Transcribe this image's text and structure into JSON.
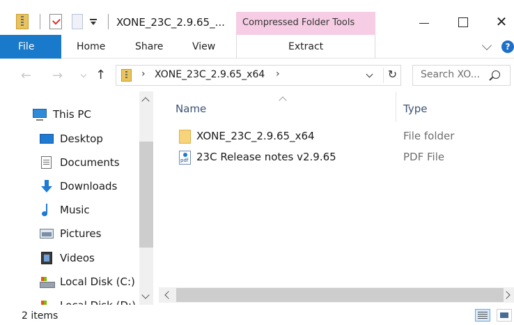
{
  "window": {
    "title": "XONE_23C_2.9.65_...",
    "context_header": "Compressed Folder Tools",
    "minimize": "Minimize",
    "maximize": "Maximize",
    "close_glyph": "✕"
  },
  "ribbon": {
    "tabs": [
      "File",
      "Home",
      "Share",
      "View",
      "Extract"
    ],
    "help_glyph": "?"
  },
  "navigation": {
    "back_glyph": "←",
    "forward_glyph": "→",
    "up_glyph": "↑",
    "refresh_glyph": "↻",
    "path_sep": "›",
    "breadcrumb": [
      "XONE_23C_2.9.65_x64"
    ],
    "search_placeholder": "Search XO..."
  },
  "nav_pane": {
    "items": [
      {
        "label": "This PC",
        "icon": "computer-icon"
      },
      {
        "label": "Desktop",
        "icon": "desktop-icon"
      },
      {
        "label": "Documents",
        "icon": "documents-icon"
      },
      {
        "label": "Downloads",
        "icon": "downloads-icon"
      },
      {
        "label": "Music",
        "icon": "music-icon"
      },
      {
        "label": "Pictures",
        "icon": "pictures-icon"
      },
      {
        "label": "Videos",
        "icon": "videos-icon"
      },
      {
        "label": "Local Disk (C:)",
        "icon": "drive-icon"
      },
      {
        "label": "Local Disk (D:)",
        "icon": "drive-icon"
      }
    ]
  },
  "file_list": {
    "columns": [
      "Name",
      "Type"
    ],
    "rows": [
      {
        "name": "XONE_23C_2.9.65_x64",
        "type": "File folder",
        "icon": "folder-icon"
      },
      {
        "name": "23C Release notes v2.9.65",
        "type": "PDF File",
        "icon": "pdf-file-icon"
      }
    ]
  },
  "status": {
    "item_count": "2 items"
  },
  "colors": {
    "file_tab": "#1979ca",
    "context_tab": "#f6cde4",
    "column_header_text": "#3b5274"
  }
}
